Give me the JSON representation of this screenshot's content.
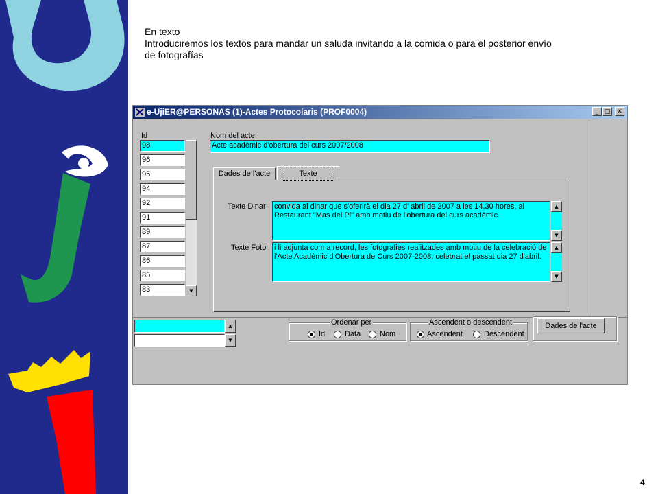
{
  "slide": {
    "heading": "En texto",
    "body_line1": "Introduciremos los textos para  mandar un saluda invitando a la comida o para el posterior envío",
    "body_line2": "de fotografías",
    "page_number": "4"
  },
  "logo": {
    "icon": "uji-logo"
  },
  "window": {
    "title": "e-UjiER@PERSONAS (1)-Actes Protocolaris (PROF0004)",
    "app_icon": "app-icon",
    "minimize": "_",
    "maximize": "□",
    "close": "✕"
  },
  "id_list": {
    "label": "Id",
    "items": [
      "98",
      "96",
      "95",
      "94",
      "92",
      "91",
      "89",
      "87",
      "86",
      "85",
      "83"
    ],
    "selected": "98"
  },
  "nom_acte": {
    "label": "Nom del acte",
    "value": "Acte acadèmic d'obertura del curs 2007/2008"
  },
  "tabs": [
    {
      "label": "Dades de l'acte",
      "active": false
    },
    {
      "label": "Texte",
      "active": true
    }
  ],
  "texte_dinar": {
    "label": "Texte Dinar",
    "line1": "convida al dinar  que s'oferirà el dia 27 d' abril de 2007  a les 14,30  hores, al",
    "line2": "Restaurant \"Mas del Pi\" amb motiu de l'obertura del curs acadèmic."
  },
  "texte_foto": {
    "label": "Texte Foto",
    "line1": "i li adjunta com a record, les fotografies realitzades amb motiu de la celebració de",
    "line2": "l'Acte Acadèmic d'Obertura de Curs 2007-2008, celebrat el passat dia 27 d'abril."
  },
  "ordenar": {
    "label": "Ordenar per",
    "options": [
      "Id",
      "Data",
      "Nom"
    ],
    "selected": "Id"
  },
  "ascendent": {
    "label": "Ascendent o descendent",
    "options": [
      "Ascendent",
      "Descendent"
    ],
    "selected": "Ascendent"
  },
  "dades_button": "Dades de l'acte",
  "colors": {
    "band": "#1f2a8c",
    "field_cyan": "#00ffff",
    "window_gray": "#c0c0c0"
  }
}
